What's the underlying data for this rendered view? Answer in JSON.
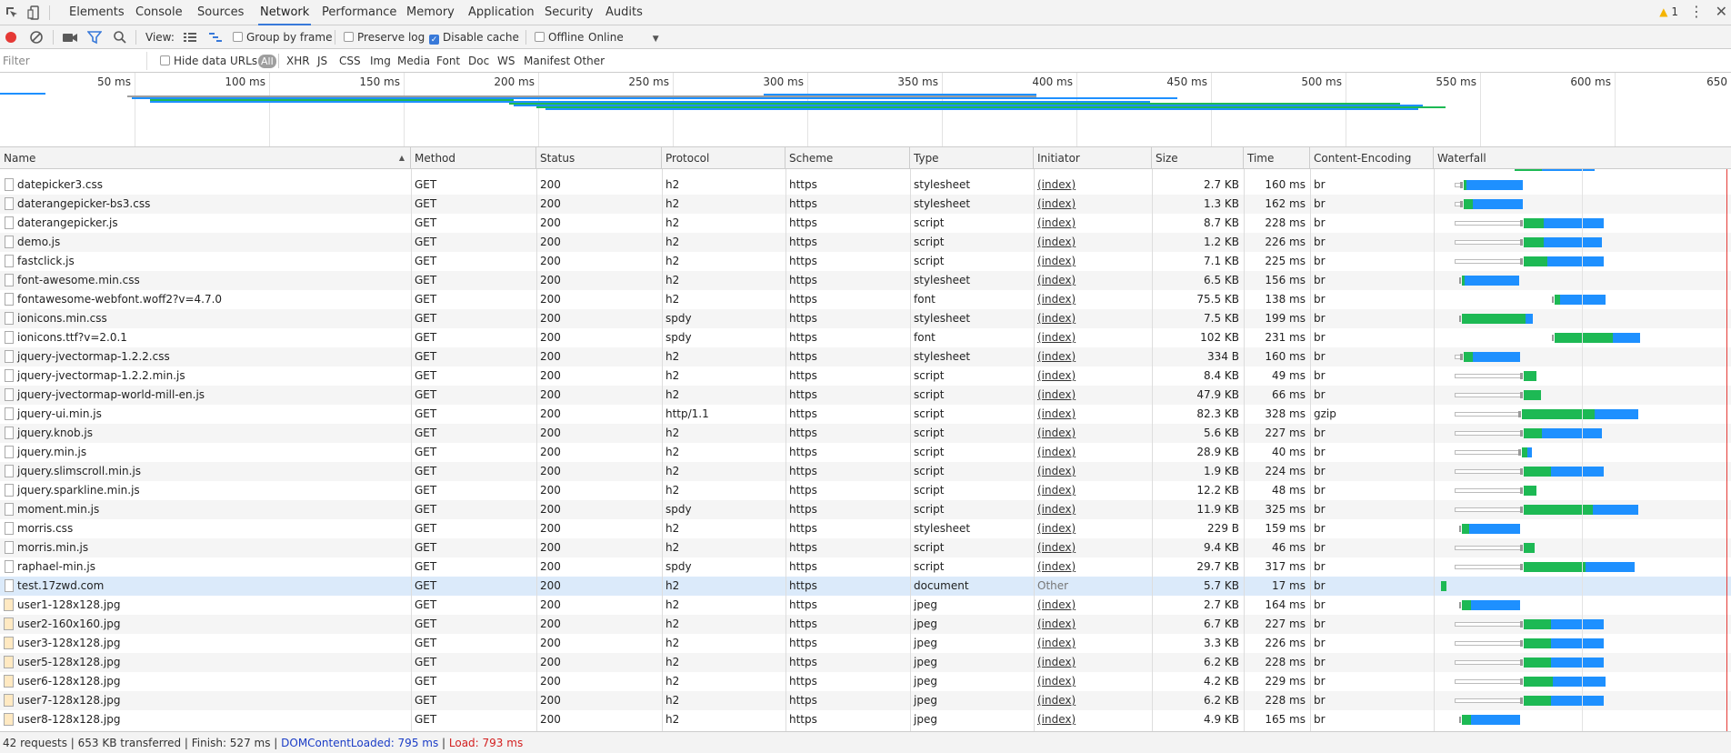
{
  "tabs": [
    "Elements",
    "Console",
    "Sources",
    "Network",
    "Performance",
    "Memory",
    "Application",
    "Security",
    "Audits"
  ],
  "active_tab": "Network",
  "warnings_count": "1",
  "toolbar": {
    "view_label": "View:",
    "group_by_frame": "Group by frame",
    "preserve_log": "Preserve log",
    "disable_cache": "Disable cache",
    "offline": "Offline",
    "throttling": "Online"
  },
  "filter": {
    "placeholder": "Filter",
    "hide_data_urls": "Hide data URLs",
    "types": [
      "All",
      "XHR",
      "JS",
      "CSS",
      "Img",
      "Media",
      "Font",
      "Doc",
      "WS",
      "Manifest",
      "Other"
    ]
  },
  "overview_ticks": [
    "50 ms",
    "100 ms",
    "150 ms",
    "200 ms",
    "250 ms",
    "300 ms",
    "350 ms",
    "400 ms",
    "450 ms",
    "500 ms",
    "550 ms",
    "600 ms",
    "650"
  ],
  "columns": [
    "Name",
    "Method",
    "Status",
    "Protocol",
    "Scheme",
    "Type",
    "Initiator",
    "Size",
    "Time",
    "Content-Encoding",
    "Waterfall"
  ],
  "rows": [
    {
      "name": "datepicker3.css",
      "method": "GET",
      "status": "200",
      "protocol": "h2",
      "scheme": "https",
      "type": "stylesheet",
      "initiator": "(index)",
      "size": "2.7 KB",
      "time": "160 ms",
      "encoding": "br",
      "wf": {
        "wait": true,
        "start": 8,
        "green": 3,
        "blue": 62
      }
    },
    {
      "name": "daterangepicker-bs3.css",
      "method": "GET",
      "status": "200",
      "protocol": "h2",
      "scheme": "https",
      "type": "stylesheet",
      "initiator": "(index)",
      "size": "1.3 KB",
      "time": "162 ms",
      "encoding": "br",
      "wf": {
        "wait": true,
        "start": 8,
        "green": 10,
        "blue": 55
      }
    },
    {
      "name": "daterangepicker.js",
      "method": "GET",
      "status": "200",
      "protocol": "h2",
      "scheme": "https",
      "type": "script",
      "initiator": "(index)",
      "size": "8.7 KB",
      "time": "228 ms",
      "encoding": "br",
      "wf": {
        "wait": true,
        "start": 74,
        "green": 22,
        "blue": 66
      }
    },
    {
      "name": "demo.js",
      "method": "GET",
      "status": "200",
      "protocol": "h2",
      "scheme": "https",
      "type": "script",
      "initiator": "(index)",
      "size": "1.2 KB",
      "time": "226 ms",
      "encoding": "br",
      "wf": {
        "wait": true,
        "start": 74,
        "green": 22,
        "blue": 64
      }
    },
    {
      "name": "fastclick.js",
      "method": "GET",
      "status": "200",
      "protocol": "h2",
      "scheme": "https",
      "type": "script",
      "initiator": "(index)",
      "size": "7.1 KB",
      "time": "225 ms",
      "encoding": "br",
      "wf": {
        "wait": true,
        "start": 74,
        "green": 26,
        "blue": 62
      }
    },
    {
      "name": "font-awesome.min.css",
      "method": "GET",
      "status": "200",
      "protocol": "h2",
      "scheme": "https",
      "type": "stylesheet",
      "initiator": "(index)",
      "size": "6.5 KB",
      "time": "156 ms",
      "encoding": "br",
      "wf": {
        "wait": false,
        "start": 6,
        "green": 3,
        "blue": 60
      }
    },
    {
      "name": "fontawesome-webfont.woff2?v=4.7.0",
      "method": "GET",
      "status": "200",
      "protocol": "h2",
      "scheme": "https",
      "type": "font",
      "initiator": "(index)",
      "size": "75.5 KB",
      "time": "138 ms",
      "encoding": "br",
      "wf": {
        "wait": false,
        "start": 108,
        "green": 6,
        "blue": 50
      }
    },
    {
      "name": "ionicons.min.css",
      "method": "GET",
      "status": "200",
      "protocol": "spdy",
      "scheme": "https",
      "type": "stylesheet",
      "initiator": "(index)",
      "size": "7.5 KB",
      "time": "199 ms",
      "encoding": "br",
      "wf": {
        "wait": false,
        "start": 6,
        "green": 70,
        "blue": 8
      }
    },
    {
      "name": "ionicons.ttf?v=2.0.1",
      "method": "GET",
      "status": "200",
      "protocol": "spdy",
      "scheme": "https",
      "type": "font",
      "initiator": "(index)",
      "size": "102 KB",
      "time": "231 ms",
      "encoding": "br",
      "wf": {
        "wait": false,
        "start": 108,
        "green": 64,
        "blue": 30
      }
    },
    {
      "name": "jquery-jvectormap-1.2.2.css",
      "method": "GET",
      "status": "200",
      "protocol": "h2",
      "scheme": "https",
      "type": "stylesheet",
      "initiator": "(index)",
      "size": "334 B",
      "time": "160 ms",
      "encoding": "br",
      "wf": {
        "wait": true,
        "start": 8,
        "green": 10,
        "blue": 52
      }
    },
    {
      "name": "jquery-jvectormap-1.2.2.min.js",
      "method": "GET",
      "status": "200",
      "protocol": "h2",
      "scheme": "https",
      "type": "script",
      "initiator": "(index)",
      "size": "8.4 KB",
      "time": "49 ms",
      "encoding": "br",
      "wf": {
        "wait": true,
        "start": 74,
        "green": 14,
        "blue": 0
      }
    },
    {
      "name": "jquery-jvectormap-world-mill-en.js",
      "method": "GET",
      "status": "200",
      "protocol": "h2",
      "scheme": "https",
      "type": "script",
      "initiator": "(index)",
      "size": "47.9 KB",
      "time": "66 ms",
      "encoding": "br",
      "wf": {
        "wait": true,
        "start": 74,
        "green": 19,
        "blue": 0
      }
    },
    {
      "name": "jquery-ui.min.js",
      "method": "GET",
      "status": "200",
      "protocol": "http/1.1",
      "scheme": "https",
      "type": "script",
      "initiator": "(index)",
      "size": "82.3 KB",
      "time": "328 ms",
      "encoding": "gzip",
      "wf": {
        "wait": true,
        "start": 72,
        "green": 80,
        "blue": 48
      }
    },
    {
      "name": "jquery.knob.js",
      "method": "GET",
      "status": "200",
      "protocol": "h2",
      "scheme": "https",
      "type": "script",
      "initiator": "(index)",
      "size": "5.6 KB",
      "time": "227 ms",
      "encoding": "br",
      "wf": {
        "wait": true,
        "start": 74,
        "green": 20,
        "blue": 66
      }
    },
    {
      "name": "jquery.min.js",
      "method": "GET",
      "status": "200",
      "protocol": "h2",
      "scheme": "https",
      "type": "script",
      "initiator": "(index)",
      "size": "28.9 KB",
      "time": "40 ms",
      "encoding": "br",
      "wf": {
        "wait": true,
        "start": 72,
        "green": 6,
        "blue": 5
      }
    },
    {
      "name": "jquery.slimscroll.min.js",
      "method": "GET",
      "status": "200",
      "protocol": "h2",
      "scheme": "https",
      "type": "script",
      "initiator": "(index)",
      "size": "1.9 KB",
      "time": "224 ms",
      "encoding": "br",
      "wf": {
        "wait": true,
        "start": 74,
        "green": 30,
        "blue": 58
      }
    },
    {
      "name": "jquery.sparkline.min.js",
      "method": "GET",
      "status": "200",
      "protocol": "h2",
      "scheme": "https",
      "type": "script",
      "initiator": "(index)",
      "size": "12.2 KB",
      "time": "48 ms",
      "encoding": "br",
      "wf": {
        "wait": true,
        "start": 74,
        "green": 14,
        "blue": 0
      }
    },
    {
      "name": "moment.min.js",
      "method": "GET",
      "status": "200",
      "protocol": "spdy",
      "scheme": "https",
      "type": "script",
      "initiator": "(index)",
      "size": "11.9 KB",
      "time": "325 ms",
      "encoding": "br",
      "wf": {
        "wait": true,
        "start": 74,
        "green": 76,
        "blue": 50
      }
    },
    {
      "name": "morris.css",
      "method": "GET",
      "status": "200",
      "protocol": "h2",
      "scheme": "https",
      "type": "stylesheet",
      "initiator": "(index)",
      "size": "229 B",
      "time": "159 ms",
      "encoding": "br",
      "wf": {
        "wait": false,
        "start": 6,
        "green": 8,
        "blue": 56
      }
    },
    {
      "name": "morris.min.js",
      "method": "GET",
      "status": "200",
      "protocol": "h2",
      "scheme": "https",
      "type": "script",
      "initiator": "(index)",
      "size": "9.4 KB",
      "time": "46 ms",
      "encoding": "br",
      "wf": {
        "wait": true,
        "start": 74,
        "green": 12,
        "blue": 0
      }
    },
    {
      "name": "raphael-min.js",
      "method": "GET",
      "status": "200",
      "protocol": "spdy",
      "scheme": "https",
      "type": "script",
      "initiator": "(index)",
      "size": "29.7 KB",
      "time": "317 ms",
      "encoding": "br",
      "wf": {
        "wait": true,
        "start": 74,
        "green": 68,
        "blue": 54
      }
    },
    {
      "name": "test.17zwd.com",
      "method": "GET",
      "status": "200",
      "protocol": "h2",
      "scheme": "https",
      "type": "document",
      "initiator": "Other",
      "size": "5.7 KB",
      "time": "17 ms",
      "encoding": "br",
      "selected": true,
      "wf": {
        "wait": false,
        "start": -17,
        "green": 6,
        "blue": 0
      }
    },
    {
      "name": "user1-128x128.jpg",
      "method": "GET",
      "status": "200",
      "protocol": "h2",
      "scheme": "https",
      "type": "jpeg",
      "initiator": "(index)",
      "size": "2.7 KB",
      "time": "164 ms",
      "encoding": "br",
      "img": true,
      "wf": {
        "wait": false,
        "start": 6,
        "green": 10,
        "blue": 54
      }
    },
    {
      "name": "user2-160x160.jpg",
      "method": "GET",
      "status": "200",
      "protocol": "h2",
      "scheme": "https",
      "type": "jpeg",
      "initiator": "(index)",
      "size": "6.7 KB",
      "time": "227 ms",
      "encoding": "br",
      "img": true,
      "wf": {
        "wait": true,
        "start": 74,
        "green": 30,
        "blue": 58
      }
    },
    {
      "name": "user3-128x128.jpg",
      "method": "GET",
      "status": "200",
      "protocol": "h2",
      "scheme": "https",
      "type": "jpeg",
      "initiator": "(index)",
      "size": "3.3 KB",
      "time": "226 ms",
      "encoding": "br",
      "img": true,
      "wf": {
        "wait": true,
        "start": 74,
        "green": 30,
        "blue": 58
      }
    },
    {
      "name": "user5-128x128.jpg",
      "method": "GET",
      "status": "200",
      "protocol": "h2",
      "scheme": "https",
      "type": "jpeg",
      "initiator": "(index)",
      "size": "6.2 KB",
      "time": "228 ms",
      "encoding": "br",
      "img": true,
      "wf": {
        "wait": true,
        "start": 74,
        "green": 30,
        "blue": 58
      }
    },
    {
      "name": "user6-128x128.jpg",
      "method": "GET",
      "status": "200",
      "protocol": "h2",
      "scheme": "https",
      "type": "jpeg",
      "initiator": "(index)",
      "size": "4.2 KB",
      "time": "229 ms",
      "encoding": "br",
      "img": true,
      "wf": {
        "wait": true,
        "start": 74,
        "green": 32,
        "blue": 58
      }
    },
    {
      "name": "user7-128x128.jpg",
      "method": "GET",
      "status": "200",
      "protocol": "h2",
      "scheme": "https",
      "type": "jpeg",
      "initiator": "(index)",
      "size": "6.2 KB",
      "time": "228 ms",
      "encoding": "br",
      "img": true,
      "wf": {
        "wait": true,
        "start": 74,
        "green": 30,
        "blue": 58
      }
    },
    {
      "name": "user8-128x128.jpg",
      "method": "GET",
      "status": "200",
      "protocol": "h2",
      "scheme": "https",
      "type": "jpeg",
      "initiator": "(index)",
      "size": "4.9 KB",
      "time": "165 ms",
      "encoding": "br",
      "img": true,
      "wf": {
        "wait": false,
        "start": 6,
        "green": 10,
        "blue": 54
      }
    }
  ],
  "status": {
    "summary": "42 requests | 653 KB transferred | Finish: 527 ms | ",
    "dom_content_loaded": "DOMContentLoaded: 795 ms",
    "separator": " | ",
    "load": "Load: 793 ms"
  },
  "colors": {
    "accent": "#3879d9",
    "waterfall_green": "#1db954",
    "waterfall_blue": "#1e90ff",
    "dcl": "#1a3cc6",
    "load": "#d32020"
  }
}
